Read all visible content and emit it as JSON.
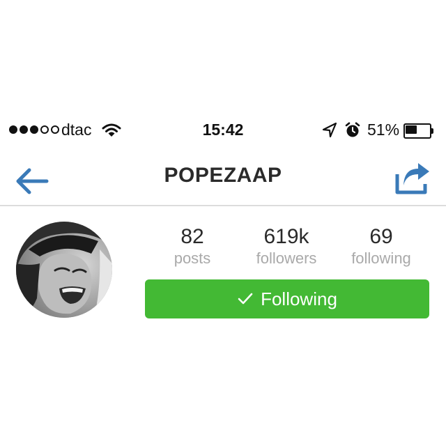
{
  "status_bar": {
    "carrier": "dtac",
    "time": "15:42",
    "battery_percent_text": "51%",
    "battery_level": 0.51,
    "signal_bars_filled": 3,
    "signal_bars_total": 5,
    "icons": [
      "wifi-icon",
      "location-arrow-icon",
      "alarm-clock-icon",
      "battery-icon"
    ]
  },
  "nav": {
    "title": "POPEZAAP",
    "back_icon": "back-arrow-icon",
    "share_icon": "share-icon",
    "accent_color": "#3a7ab8"
  },
  "profile": {
    "stats": [
      {
        "value": "82",
        "label": "posts"
      },
      {
        "value": "619k",
        "label": "followers"
      },
      {
        "value": "69",
        "label": "following"
      }
    ],
    "follow_button": {
      "label": "Following",
      "icon": "checkmark-icon",
      "color": "#43b934"
    }
  }
}
